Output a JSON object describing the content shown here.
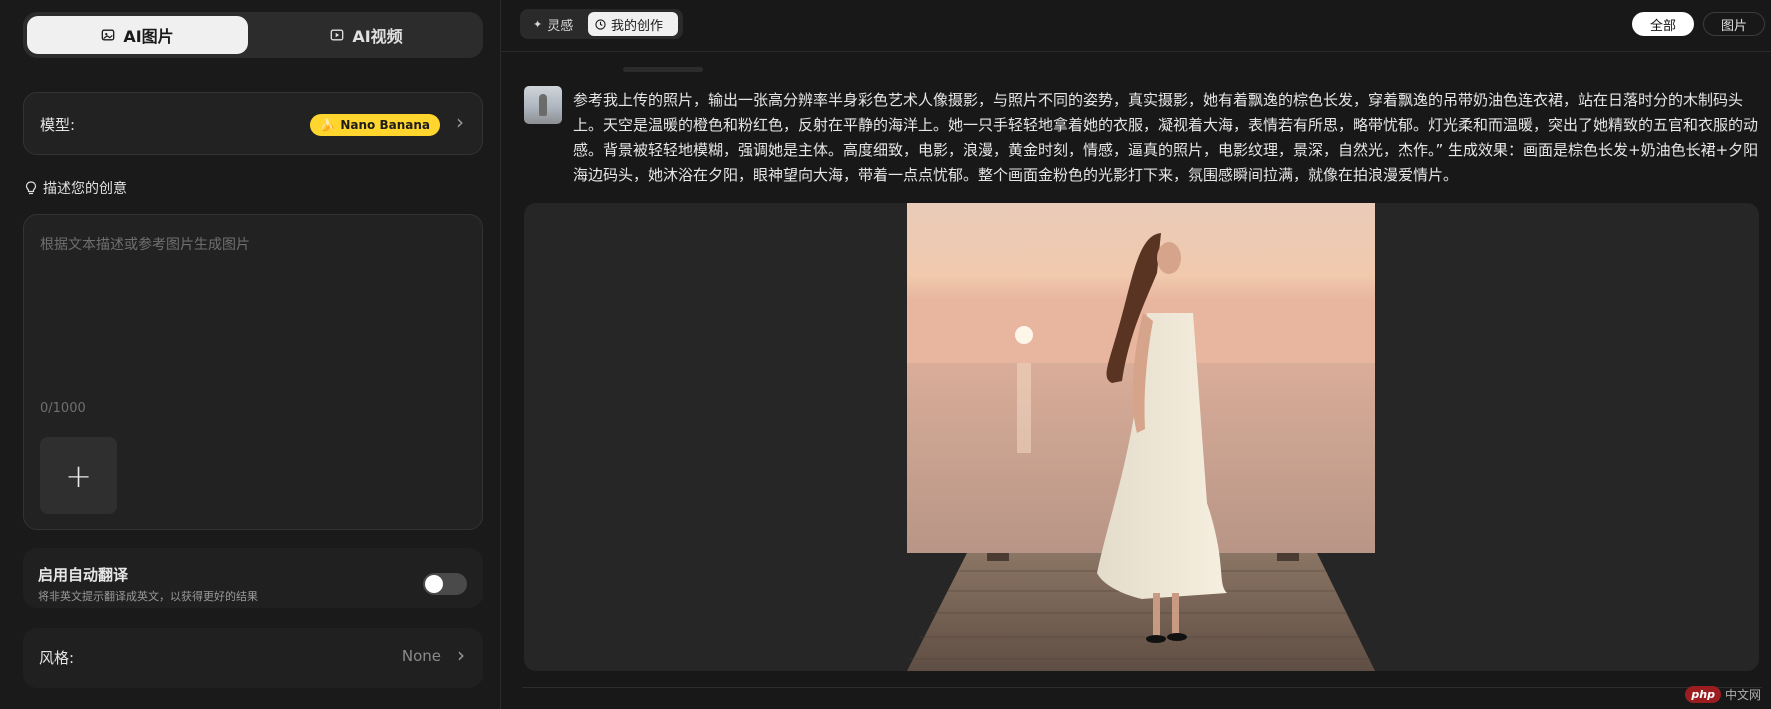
{
  "sidebar": {
    "modes": [
      {
        "label": "AI图片",
        "active": true,
        "icon": "image-spark-icon"
      },
      {
        "label": "AI视频",
        "active": false,
        "icon": "video-spark-icon"
      }
    ],
    "model": {
      "label": "模型:",
      "value": "Nano Banana",
      "icon": "banana-icon"
    },
    "describe": {
      "heading": "描述您的创意",
      "icon": "lightbulb-icon"
    },
    "prompt": {
      "placeholder": "根据文本描述或参考图片生成图片",
      "counter": "0/1000",
      "value": ""
    },
    "translate": {
      "title": "启用自动翻译",
      "subtitle": "将非英文提示翻译成英文，以获得更好的结果",
      "enabled": false
    },
    "style": {
      "label": "风格:",
      "value": "None"
    }
  },
  "main": {
    "tabs": [
      {
        "label": "灵感",
        "icon": "sparkle-icon",
        "active": false
      },
      {
        "label": "我的创作",
        "icon": "clock-icon",
        "active": true
      }
    ],
    "filters": [
      {
        "label": "全部",
        "active": true
      },
      {
        "label": "图片",
        "active": false
      }
    ],
    "message": {
      "prompt": "参考我上传的照片，输出一张高分辨率半身彩色艺术人像摄影，与照片不同的姿势，真实摄影，她有着飘逸的棕色长发，穿着飘逸的吊带奶油色连衣裙，站在日落时分的木制码头上。天空是温暖的橙色和粉红色，反射在平静的海洋上。她一只手轻轻地拿着她的衣服，凝视着大海，表情若有所思，略带忧郁。灯光柔和而温暖，突出了她精致的五官和衣服的动感。背景被轻轻地模糊，强调她是主体。高度细致，电影，浪漫，黄金时刻，情感，逼真的照片，电影纹理，景深，自然光，杰作。” 生成效果：画面是棕色长发+奶油色长裙+夕阳海边码头，她沐浴在夕阳，眼神望向大海，带着一点点忧郁。整个画面金粉色的光影打下来，氛围感瞬间拉满，就像在拍浪漫爱情片。"
    }
  },
  "watermark": {
    "logo": "php",
    "text": "中文网"
  },
  "colors": {
    "accent_yellow": "#ffd52e",
    "bg": "#181818",
    "panel": "#222222"
  }
}
